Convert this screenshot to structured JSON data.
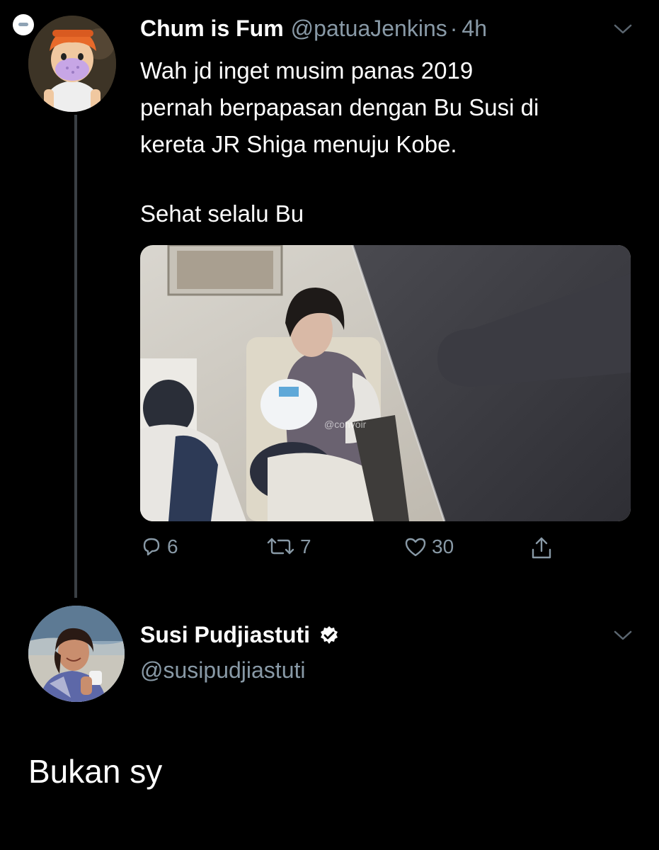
{
  "tweet": {
    "display_name": "Chum is Fum",
    "handle": "@patuaJenkins",
    "separator": "·",
    "time": "4h",
    "text": "Wah jd inget musim panas 2019\npernah berpapasan dengan Bu Susi di\nkereta JR Shiga menuju Kobe.",
    "text_2": "Sehat selalu Bu",
    "media_watermark": "@convoir",
    "stats": {
      "replies": "6",
      "retweets": "7",
      "likes": "30"
    }
  },
  "reply": {
    "display_name": "Susi Pudjiastuti",
    "handle": "@susipudjiastuti",
    "text": "Bukan sy"
  },
  "colors": {
    "background": "#000000",
    "secondary_text": "#8899a6",
    "thread_line": "#3a3f44"
  },
  "icons": {
    "reply": "speech-bubble-icon",
    "retweet": "retweet-arrows-icon",
    "like": "heart-icon",
    "share": "share-upload-icon",
    "verified": "verified-badge-icon",
    "menu": "chevron-down-icon"
  }
}
